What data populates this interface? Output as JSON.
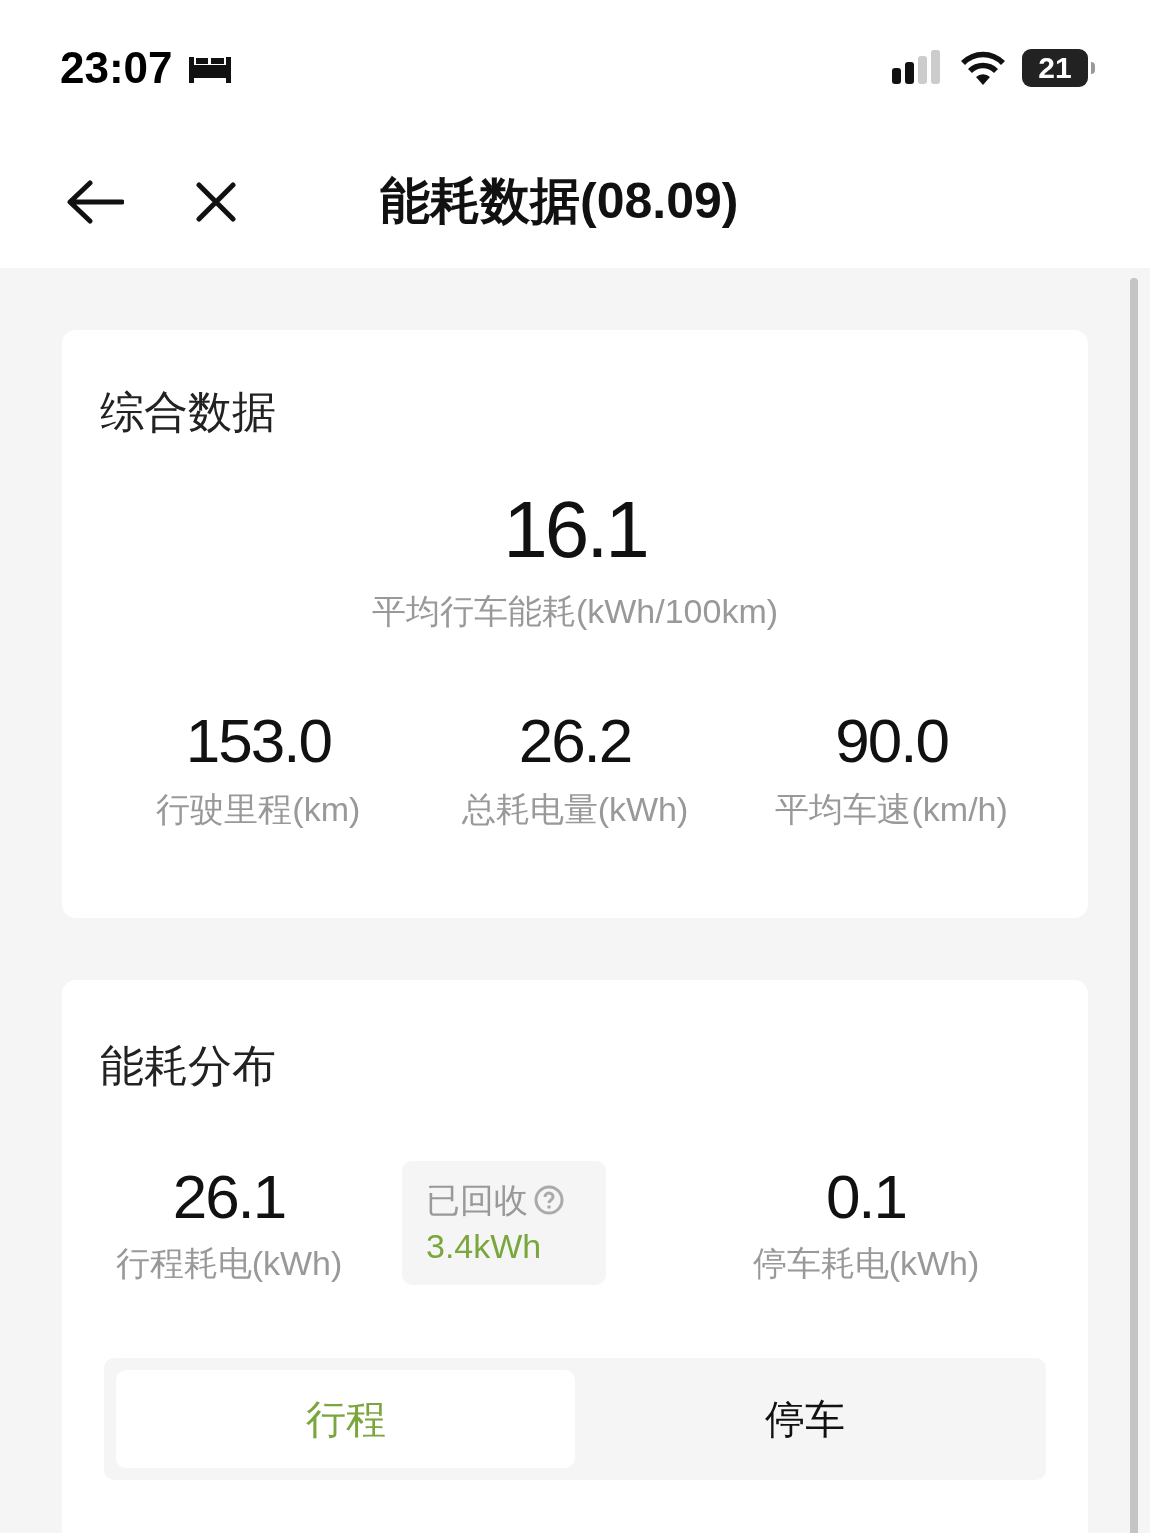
{
  "status_bar": {
    "time": "23:07",
    "battery": "21"
  },
  "header": {
    "title": "能耗数据(08.09)"
  },
  "summary": {
    "title": "综合数据",
    "main": {
      "value": "16.1",
      "label": "平均行车能耗(kWh/100km)"
    },
    "stats": [
      {
        "value": "153.0",
        "label": "行驶里程(km)"
      },
      {
        "value": "26.2",
        "label": "总耗电量(kWh)"
      },
      {
        "value": "90.0",
        "label": "平均车速(km/h)"
      }
    ]
  },
  "distribution": {
    "title": "能耗分布",
    "trip": {
      "value": "26.1",
      "label": "行程耗电(kWh)"
    },
    "recovered": {
      "label": "已回收",
      "value": "3.4kWh"
    },
    "parking": {
      "value": "0.1",
      "label": "停车耗电(kWh)"
    },
    "tabs": [
      {
        "label": "行程",
        "selected": true
      },
      {
        "label": "停车",
        "selected": false
      }
    ]
  }
}
